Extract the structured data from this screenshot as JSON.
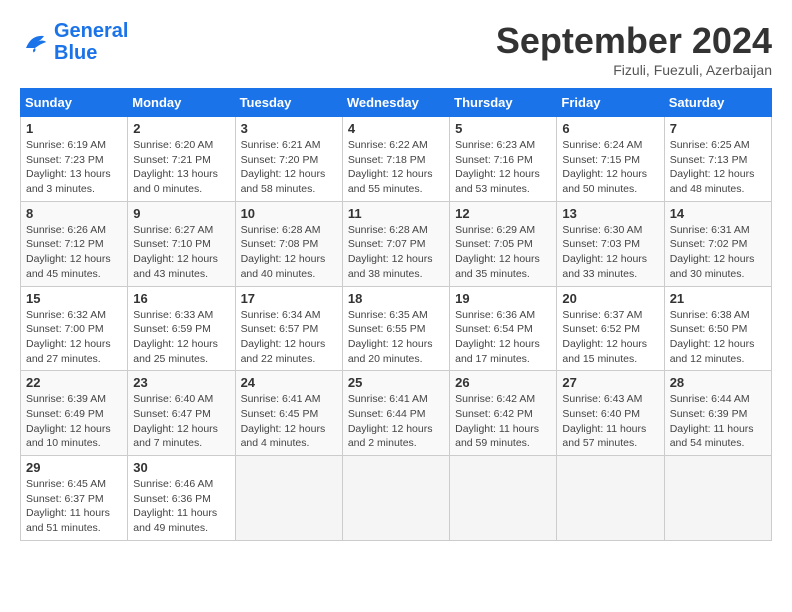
{
  "header": {
    "logo_line1": "General",
    "logo_line2": "Blue",
    "month_title": "September 2024",
    "subtitle": "Fizuli, Fuezuli, Azerbaijan"
  },
  "weekdays": [
    "Sunday",
    "Monday",
    "Tuesday",
    "Wednesday",
    "Thursday",
    "Friday",
    "Saturday"
  ],
  "weeks": [
    [
      {
        "day": "1",
        "info": "Sunrise: 6:19 AM\nSunset: 7:23 PM\nDaylight: 13 hours\nand 3 minutes."
      },
      {
        "day": "2",
        "info": "Sunrise: 6:20 AM\nSunset: 7:21 PM\nDaylight: 13 hours\nand 0 minutes."
      },
      {
        "day": "3",
        "info": "Sunrise: 6:21 AM\nSunset: 7:20 PM\nDaylight: 12 hours\nand 58 minutes."
      },
      {
        "day": "4",
        "info": "Sunrise: 6:22 AM\nSunset: 7:18 PM\nDaylight: 12 hours\nand 55 minutes."
      },
      {
        "day": "5",
        "info": "Sunrise: 6:23 AM\nSunset: 7:16 PM\nDaylight: 12 hours\nand 53 minutes."
      },
      {
        "day": "6",
        "info": "Sunrise: 6:24 AM\nSunset: 7:15 PM\nDaylight: 12 hours\nand 50 minutes."
      },
      {
        "day": "7",
        "info": "Sunrise: 6:25 AM\nSunset: 7:13 PM\nDaylight: 12 hours\nand 48 minutes."
      }
    ],
    [
      {
        "day": "8",
        "info": "Sunrise: 6:26 AM\nSunset: 7:12 PM\nDaylight: 12 hours\nand 45 minutes."
      },
      {
        "day": "9",
        "info": "Sunrise: 6:27 AM\nSunset: 7:10 PM\nDaylight: 12 hours\nand 43 minutes."
      },
      {
        "day": "10",
        "info": "Sunrise: 6:28 AM\nSunset: 7:08 PM\nDaylight: 12 hours\nand 40 minutes."
      },
      {
        "day": "11",
        "info": "Sunrise: 6:28 AM\nSunset: 7:07 PM\nDaylight: 12 hours\nand 38 minutes."
      },
      {
        "day": "12",
        "info": "Sunrise: 6:29 AM\nSunset: 7:05 PM\nDaylight: 12 hours\nand 35 minutes."
      },
      {
        "day": "13",
        "info": "Sunrise: 6:30 AM\nSunset: 7:03 PM\nDaylight: 12 hours\nand 33 minutes."
      },
      {
        "day": "14",
        "info": "Sunrise: 6:31 AM\nSunset: 7:02 PM\nDaylight: 12 hours\nand 30 minutes."
      }
    ],
    [
      {
        "day": "15",
        "info": "Sunrise: 6:32 AM\nSunset: 7:00 PM\nDaylight: 12 hours\nand 27 minutes."
      },
      {
        "day": "16",
        "info": "Sunrise: 6:33 AM\nSunset: 6:59 PM\nDaylight: 12 hours\nand 25 minutes."
      },
      {
        "day": "17",
        "info": "Sunrise: 6:34 AM\nSunset: 6:57 PM\nDaylight: 12 hours\nand 22 minutes."
      },
      {
        "day": "18",
        "info": "Sunrise: 6:35 AM\nSunset: 6:55 PM\nDaylight: 12 hours\nand 20 minutes."
      },
      {
        "day": "19",
        "info": "Sunrise: 6:36 AM\nSunset: 6:54 PM\nDaylight: 12 hours\nand 17 minutes."
      },
      {
        "day": "20",
        "info": "Sunrise: 6:37 AM\nSunset: 6:52 PM\nDaylight: 12 hours\nand 15 minutes."
      },
      {
        "day": "21",
        "info": "Sunrise: 6:38 AM\nSunset: 6:50 PM\nDaylight: 12 hours\nand 12 minutes."
      }
    ],
    [
      {
        "day": "22",
        "info": "Sunrise: 6:39 AM\nSunset: 6:49 PM\nDaylight: 12 hours\nand 10 minutes."
      },
      {
        "day": "23",
        "info": "Sunrise: 6:40 AM\nSunset: 6:47 PM\nDaylight: 12 hours\nand 7 minutes."
      },
      {
        "day": "24",
        "info": "Sunrise: 6:41 AM\nSunset: 6:45 PM\nDaylight: 12 hours\nand 4 minutes."
      },
      {
        "day": "25",
        "info": "Sunrise: 6:41 AM\nSunset: 6:44 PM\nDaylight: 12 hours\nand 2 minutes."
      },
      {
        "day": "26",
        "info": "Sunrise: 6:42 AM\nSunset: 6:42 PM\nDaylight: 11 hours\nand 59 minutes."
      },
      {
        "day": "27",
        "info": "Sunrise: 6:43 AM\nSunset: 6:40 PM\nDaylight: 11 hours\nand 57 minutes."
      },
      {
        "day": "28",
        "info": "Sunrise: 6:44 AM\nSunset: 6:39 PM\nDaylight: 11 hours\nand 54 minutes."
      }
    ],
    [
      {
        "day": "29",
        "info": "Sunrise: 6:45 AM\nSunset: 6:37 PM\nDaylight: 11 hours\nand 51 minutes."
      },
      {
        "day": "30",
        "info": "Sunrise: 6:46 AM\nSunset: 6:36 PM\nDaylight: 11 hours\nand 49 minutes."
      },
      {
        "day": "",
        "info": ""
      },
      {
        "day": "",
        "info": ""
      },
      {
        "day": "",
        "info": ""
      },
      {
        "day": "",
        "info": ""
      },
      {
        "day": "",
        "info": ""
      }
    ]
  ]
}
